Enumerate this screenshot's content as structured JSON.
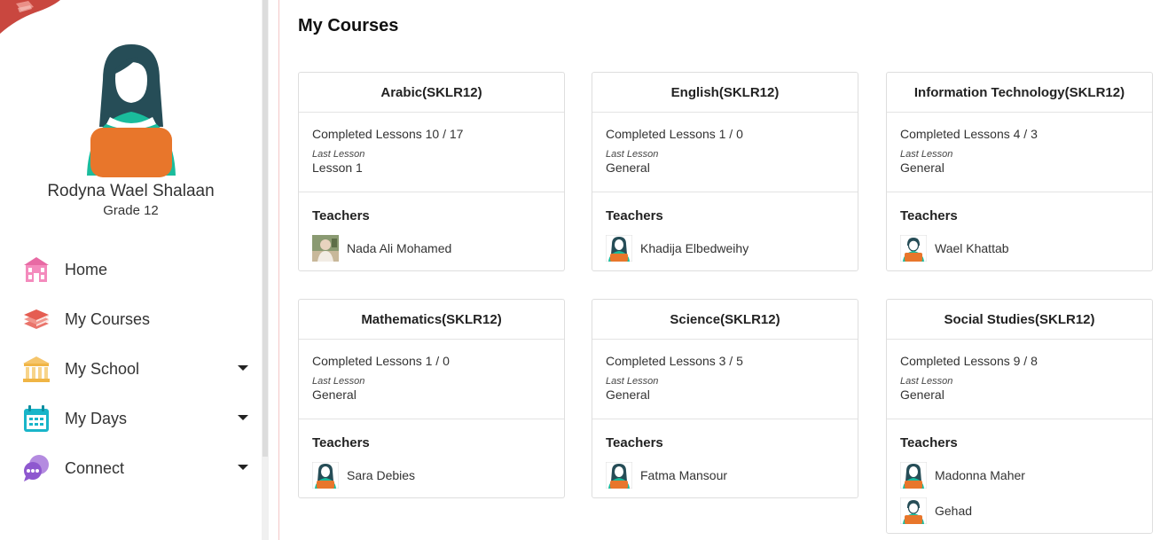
{
  "profile": {
    "name": "Rodyna Wael Shalaan",
    "grade": "Grade 12"
  },
  "nav": [
    {
      "label": "Home",
      "icon": "school-home-icon",
      "has_dropdown": false
    },
    {
      "label": "My Courses",
      "icon": "books-stack-icon",
      "has_dropdown": false
    },
    {
      "label": "My School",
      "icon": "building-columns-icon",
      "has_dropdown": true
    },
    {
      "label": "My Days",
      "icon": "calendar-icon",
      "has_dropdown": true
    },
    {
      "label": "Connect",
      "icon": "chat-bubbles-icon",
      "has_dropdown": true
    }
  ],
  "page_title": "My Courses",
  "labels": {
    "last_lesson": "Last Lesson",
    "teachers": "Teachers"
  },
  "courses": [
    {
      "title": "Arabic(SKLR12)",
      "completed": "Completed Lessons 10 / 17",
      "last_lesson": "Lesson 1",
      "teachers": [
        {
          "name": "Nada Ali Mohamed",
          "avatar": "photo"
        }
      ]
    },
    {
      "title": "English(SKLR12)",
      "completed": "Completed Lessons 1 / 0",
      "last_lesson": "General",
      "teachers": [
        {
          "name": "Khadija Elbedweihy",
          "avatar": "female-default"
        }
      ]
    },
    {
      "title": "Information Technology(SKLR12)",
      "completed": "Completed Lessons 4 / 3",
      "last_lesson": "General",
      "teachers": [
        {
          "name": "Wael Khattab",
          "avatar": "male-default"
        }
      ]
    },
    {
      "title": "Mathematics(SKLR12)",
      "completed": "Completed Lessons 1 / 0",
      "last_lesson": "General",
      "teachers": [
        {
          "name": "Sara Debies",
          "avatar": "female-default"
        }
      ]
    },
    {
      "title": "Science(SKLR12)",
      "completed": "Completed Lessons 3 / 5",
      "last_lesson": "General",
      "teachers": [
        {
          "name": "Fatma Mansour",
          "avatar": "female-default"
        }
      ]
    },
    {
      "title": "Social Studies(SKLR12)",
      "completed": "Completed Lessons 9 / 8",
      "last_lesson": "General",
      "teachers": [
        {
          "name": "Madonna Maher",
          "avatar": "female-default"
        },
        {
          "name": "Gehad",
          "avatar": "male-default"
        }
      ]
    }
  ],
  "colors": {
    "accent_red": "#d9534f",
    "avatar_orange": "#e8762b",
    "avatar_teal": "#1abc9c",
    "avatar_hair": "#264d57"
  }
}
